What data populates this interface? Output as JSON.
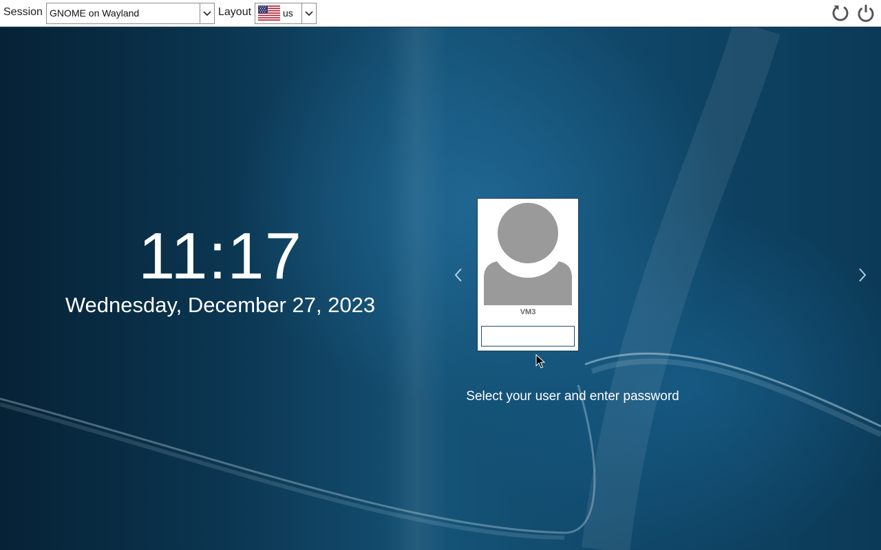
{
  "topbar": {
    "session_label": "Session",
    "session_value": "GNOME on Wayland",
    "layout_label": "Layout",
    "layout_value": "us",
    "layout_flag_icon": "us-flag-icon",
    "restart_icon": "restart-icon",
    "shutdown_icon": "power-icon"
  },
  "clock": {
    "time": "11:17",
    "date": "Wednesday, December 27, 2023"
  },
  "user_selector": {
    "user_name": "VM3",
    "password_value": "",
    "prev_icon": "chevron-left-icon",
    "next_icon": "chevron-right-icon",
    "hint": "Select your user and enter password"
  },
  "colors": {
    "background_dark": "#062236",
    "background_mid": "#155377",
    "card_border": "#1f4c70",
    "icon_gray": "#555555",
    "avatar_gray": "#9a9a9a"
  }
}
